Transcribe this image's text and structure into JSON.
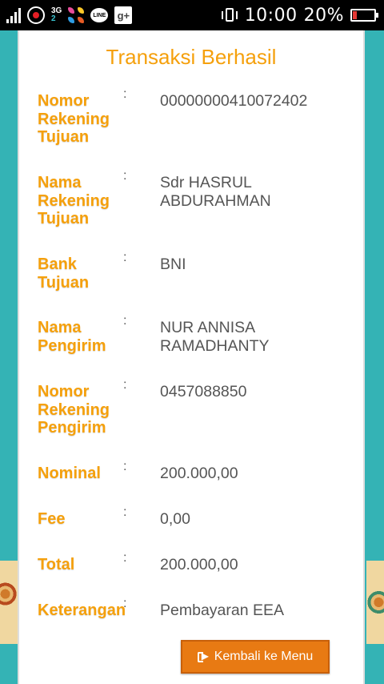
{
  "status_bar": {
    "network_label": "3G",
    "sim_label": "2",
    "line_label": "LINE",
    "gplus_label": "g+",
    "time": "10:00",
    "battery_percent": "20%",
    "battery_level": 0.2,
    "battery_color": "#e53935"
  },
  "page": {
    "title": "Transaksi Berhasil",
    "accent_color": "#f5a00c",
    "button_color": "#e87a13"
  },
  "details": [
    {
      "label": "Nomor Rekening Tujuan",
      "separator": ":",
      "value": "00000000410072402"
    },
    {
      "label": "Nama Rekening Tujuan",
      "separator": ":",
      "value": "Sdr HASRUL ABDURAHMAN"
    },
    {
      "label": "Bank Tujuan",
      "separator": ":",
      "value": "BNI"
    },
    {
      "label": "Nama Pengirim",
      "separator": ":",
      "value": "NUR ANNISA RAMADHANTY"
    },
    {
      "label": "Nomor Rekening Pengirim",
      "separator": ":",
      "value": "0457088850"
    },
    {
      "label": "Nominal",
      "separator": ":",
      "value": "200.000,00"
    },
    {
      "label": "Fee",
      "separator": ":",
      "value": "0,00"
    },
    {
      "label": "Total",
      "separator": ":",
      "value": "200.000,00"
    },
    {
      "label": "Keterangan",
      "separator": ":",
      "value": "Pembayaran EEA"
    }
  ],
  "actions": {
    "back_label": "Kembali ke Menu",
    "back_icon": "exit-icon"
  }
}
